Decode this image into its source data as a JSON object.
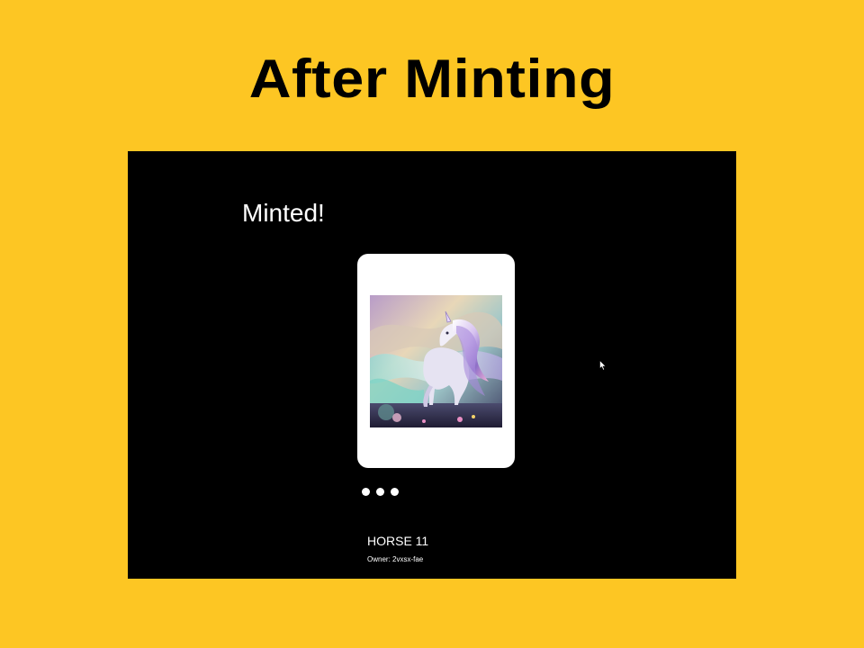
{
  "slide": {
    "title": "After Minting",
    "background_color": "#FDC623"
  },
  "app": {
    "background_color": "#000000",
    "heading": "Minted!",
    "nft": {
      "name": "HORSE 11",
      "owner": "Owner: 2vxsx-fae",
      "image_icon": "unicorn-artwork"
    },
    "carousel": {
      "dot_count": 3
    }
  }
}
